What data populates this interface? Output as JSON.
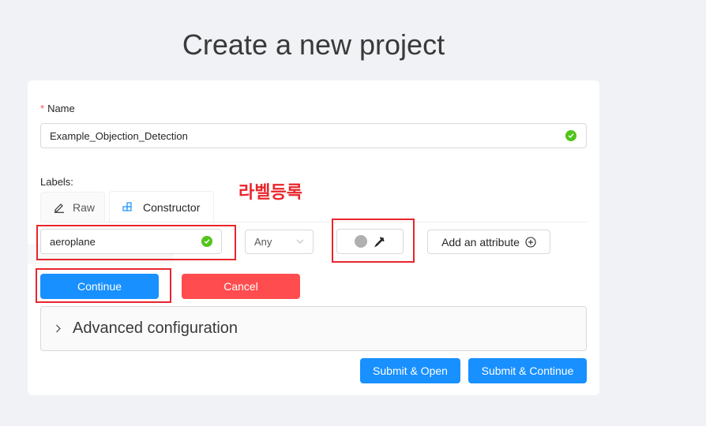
{
  "page": {
    "title": "Create a new project"
  },
  "form": {
    "name_label": "Name",
    "required_mark": "*",
    "name_value": "Example_Objection_Detection",
    "labels_title": "Labels:",
    "tabs": [
      {
        "label": "Raw",
        "icon": "pencil-icon"
      },
      {
        "label": "Constructor",
        "icon": "constructor-icon"
      }
    ],
    "label_name_value": "aeroplane",
    "label_type_value": "Any",
    "color_swatch": "#b0b0b0",
    "add_attribute_label": "Add an attribute",
    "continue_label": "Continue",
    "cancel_label": "Cancel",
    "advanced_label": "Advanced configuration",
    "submit_open_label": "Submit & Open",
    "submit_continue_label": "Submit & Continue"
  },
  "annotation": {
    "text": "라벨등록",
    "color": "#e8262d"
  },
  "colors": {
    "primary": "#1890ff",
    "danger": "#ff4d4f",
    "success": "#52c41a"
  }
}
